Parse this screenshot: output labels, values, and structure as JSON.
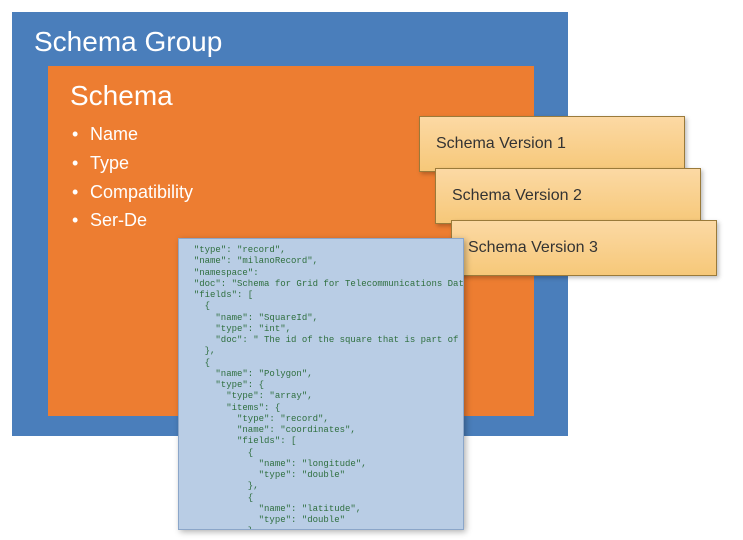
{
  "schemaGroup": {
    "title": "Schema Group"
  },
  "schema": {
    "title": "Schema",
    "attributes": [
      "Name",
      "Type",
      "Compatibility",
      "Ser-De"
    ]
  },
  "versions": {
    "v1": "Schema Version 1",
    "v2": "Schema Version 2",
    "v3": "Schema Version 3"
  },
  "codeSnippet": "  \"type\": \"record\",\n  \"name\": \"milanoRecord\",\n  \"namespace\":\n  \"doc\": \"Schema for Grid for Telecommunications Data from Te\",\n  \"fields\": [\n    {\n      \"name\": \"SquareId\",\n      \"type\": \"int\",\n      \"doc\": \" The id of the square that is part of t\n    },\n    {\n      \"name\": \"Polygon\",\n      \"type\": {\n        \"type\": \"array\",\n        \"items\": {\n          \"type\": \"record\",\n          \"name\": \"coordinates\",\n          \"fields\": [\n            {\n              \"name\": \"longitude\",\n              \"type\": \"double\"\n            },\n            {\n              \"name\": \"latitude\",\n              \"type\": \"double\"\n            }\n          ]\n        }\n      }\n    }\n  ]\n}"
}
